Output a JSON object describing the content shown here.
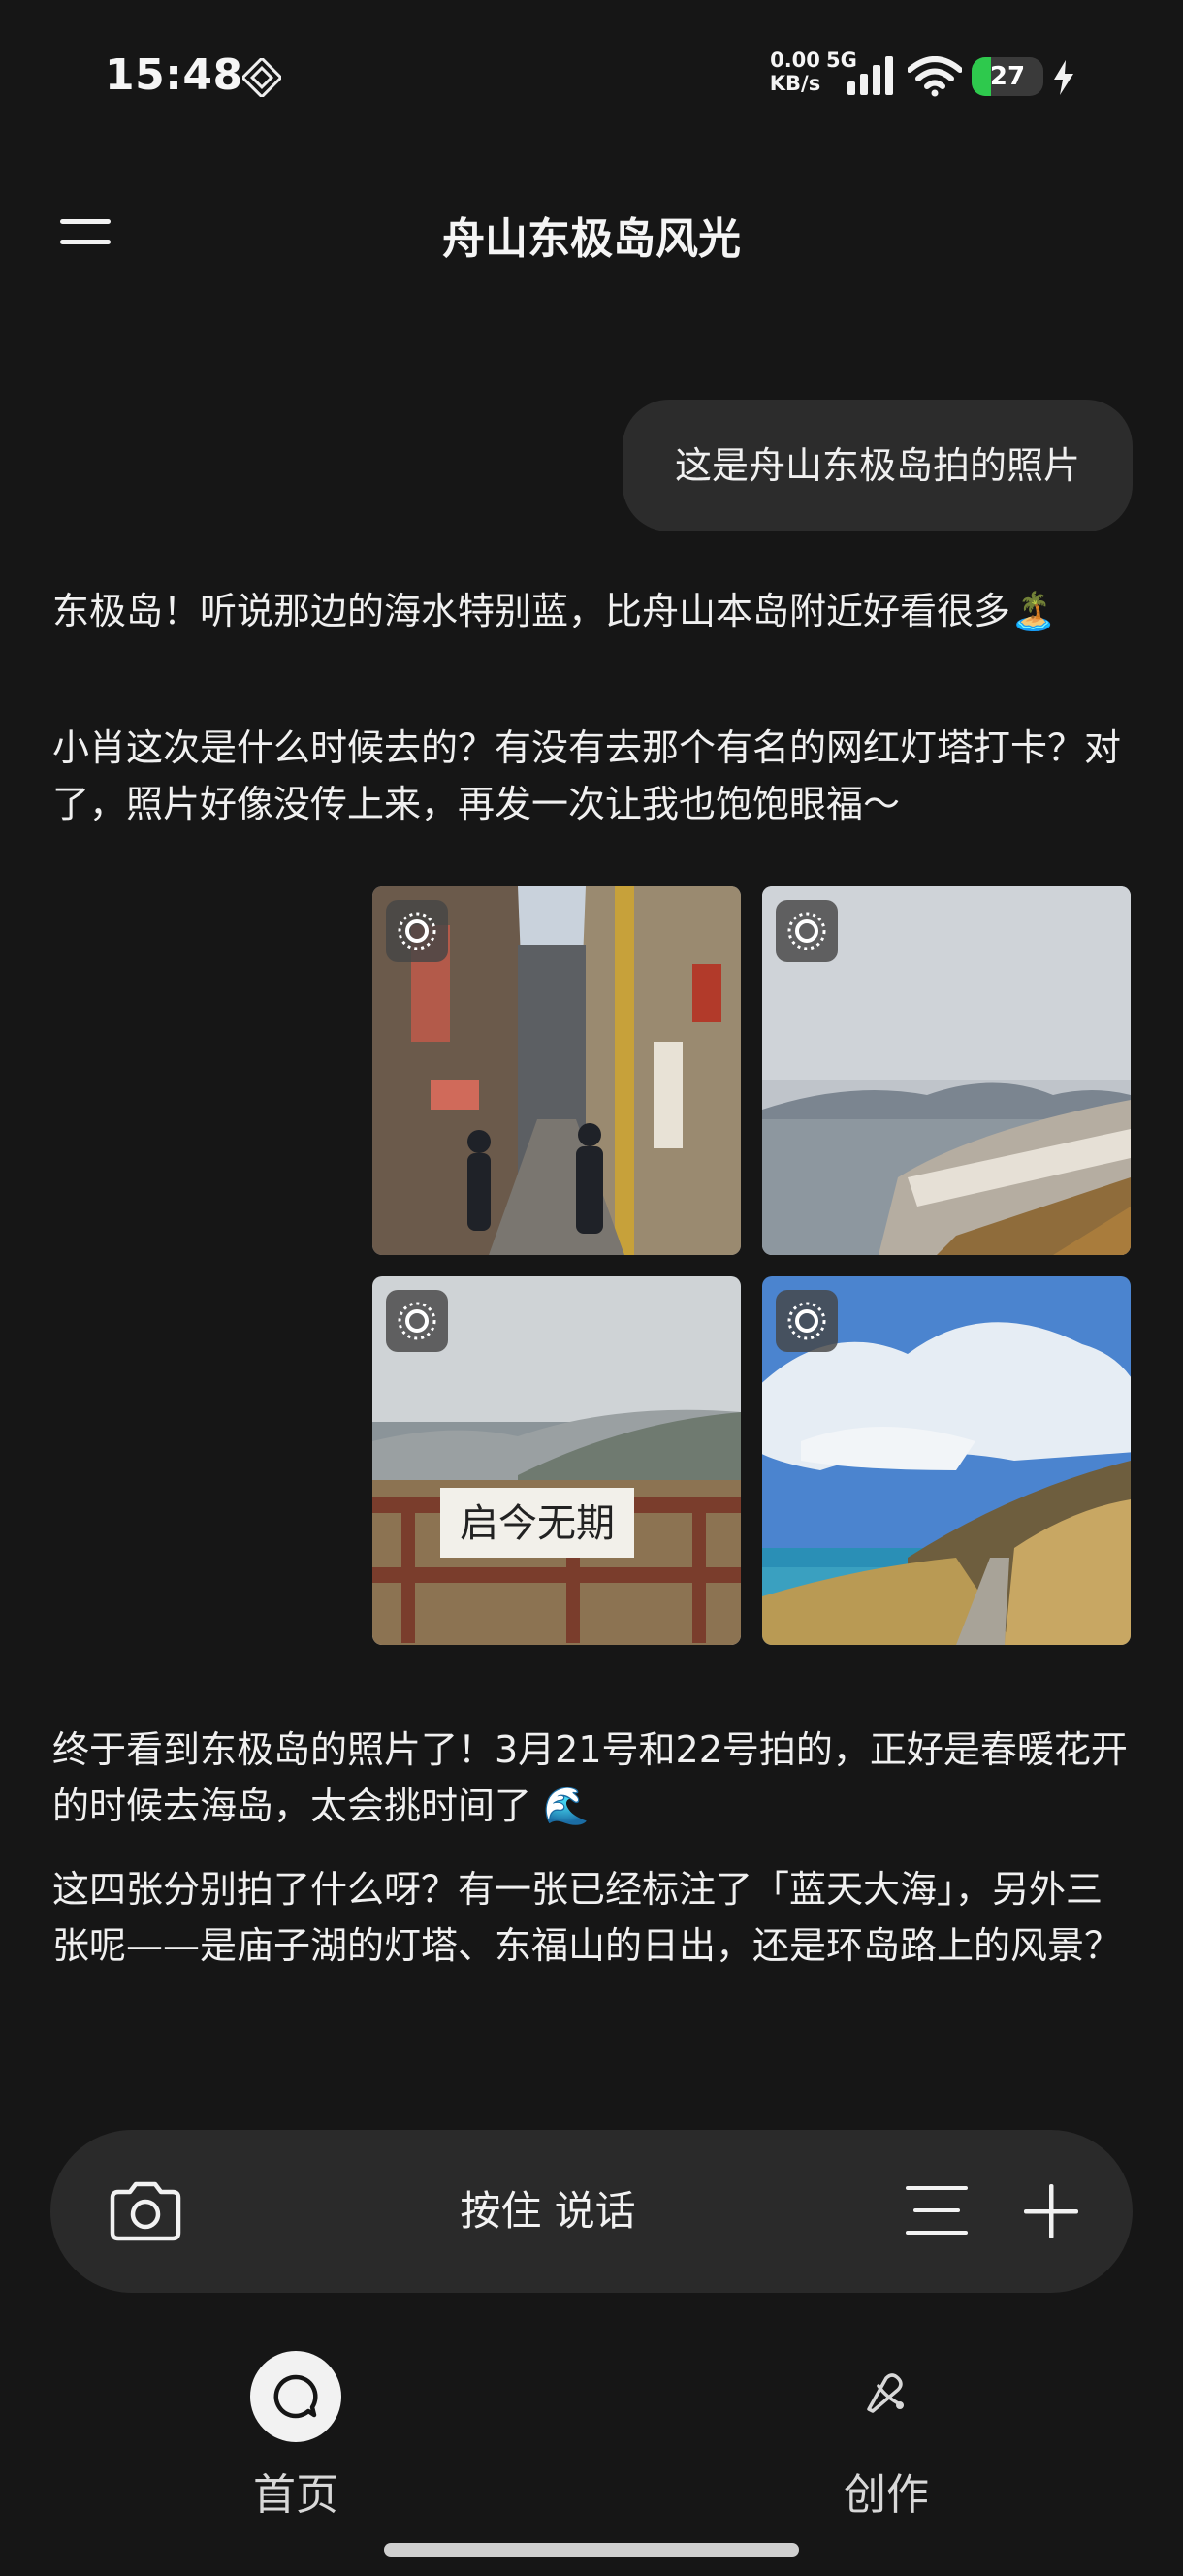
{
  "status_bar": {
    "time": "15:48",
    "net_speed_value": "0.00",
    "net_speed_unit": "KB/s",
    "network_type": "5G",
    "battery_level": "27",
    "icons": [
      "nfc-icon",
      "signal-icon",
      "wifi-icon",
      "battery-icon",
      "charging-bolt-icon"
    ]
  },
  "header": {
    "title": "舟山东极岛风光",
    "menu_icon": "menu-icon"
  },
  "messages": {
    "user": "这是舟山东极岛拍的照片",
    "assistant_1": "东极岛！听说那边的海水特别蓝，比舟山本岛附近好看很多🏝️",
    "assistant_2": "小肖这次是什么时候去的？有没有去那个有名的网红灯塔打卡？对了，照片好像没传上来，再发一次让我也饱饱眼福～",
    "photos": [
      {
        "scene": "street",
        "badge_icon": "sun-icon"
      },
      {
        "scene": "coast-town",
        "badge_icon": "sun-icon"
      },
      {
        "scene": "sign",
        "sign_text": "启今无期",
        "badge_icon": "sun-icon"
      },
      {
        "scene": "sea-path",
        "badge_icon": "sun-icon"
      }
    ],
    "assistant_3": "终于看到东极岛的照片了！3月21号和22号拍的，正好是春暖花开的时候去海岛，太会挑时间了 🌊",
    "assistant_4": "这四张分别拍了什么呀？有一张已经标注了「蓝天大海」，另外三张呢——是庙子湖的灯塔、东福山的日出，还是环岛路上的风景？"
  },
  "input_bar": {
    "voice_label": "按住 说话",
    "icons": [
      "camera-icon",
      "list-icon",
      "plus-icon"
    ]
  },
  "bottom_nav": {
    "home_label": "首页",
    "create_label": "创作",
    "icons": [
      "chat-icon",
      "create-icon"
    ]
  },
  "colors": {
    "background": "#161616",
    "bubble": "#2c2c2c",
    "input_bar": "#2a2a2a",
    "battery_fill": "#2ec94d"
  }
}
